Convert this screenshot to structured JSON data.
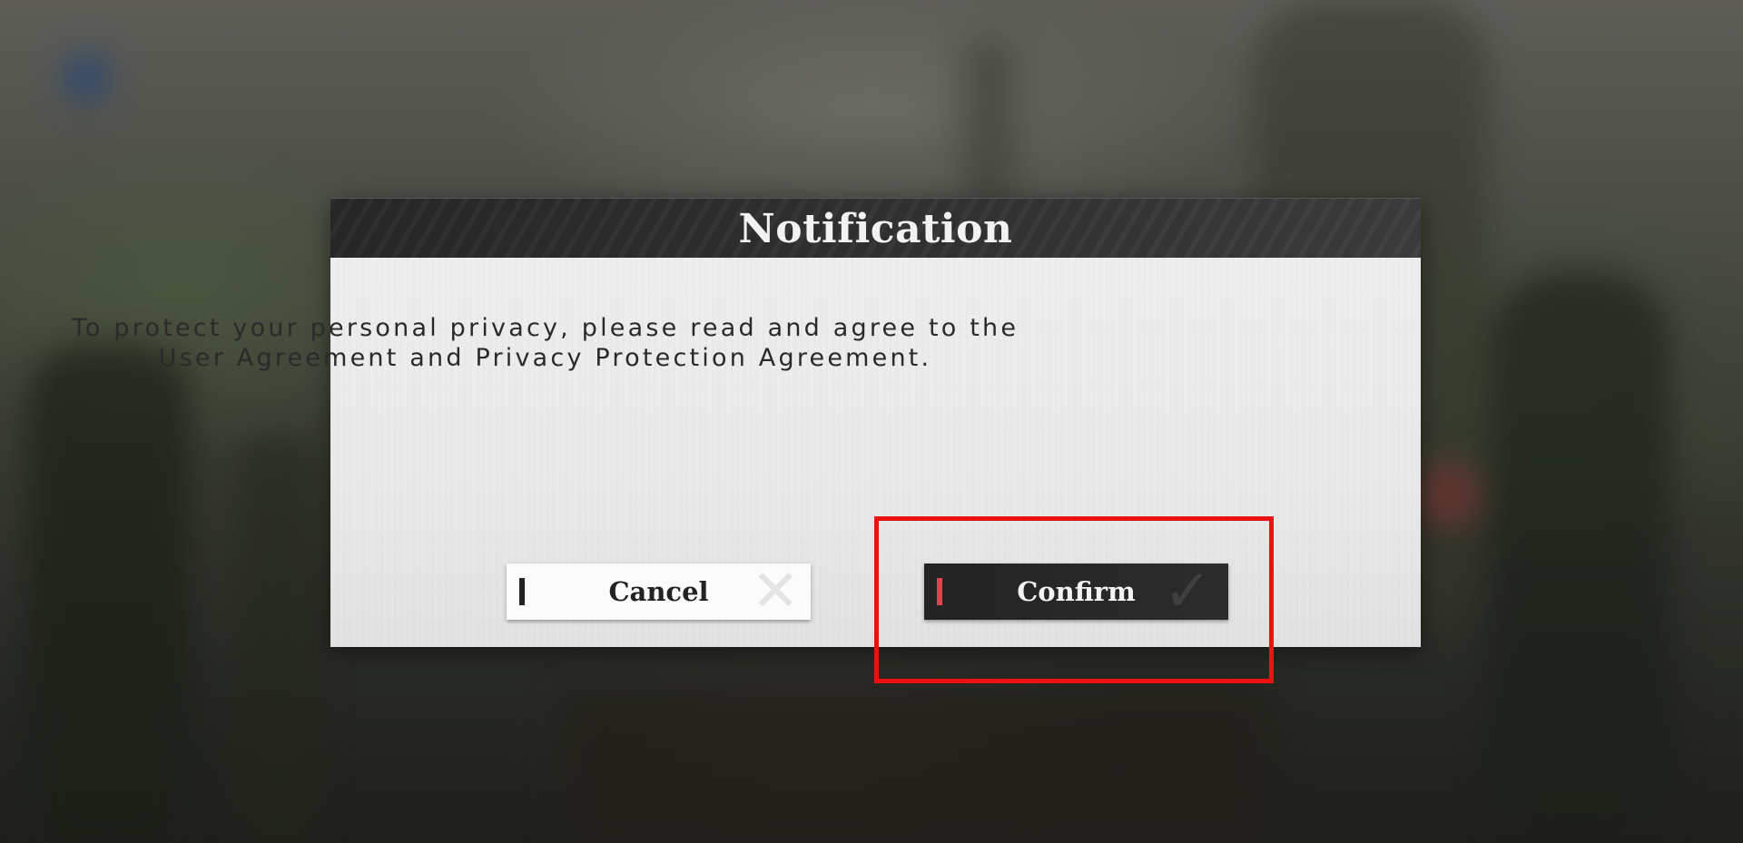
{
  "dialog": {
    "title": "Notification",
    "message_lines": [
      "To protect your personal privacy, please read and agree to the",
      "User Agreement and Privacy Protection Agreement."
    ],
    "cancel_label": "Cancel",
    "confirm_label": "Confirm",
    "cancel_icon": "close-icon",
    "confirm_icon": "checkmark-icon"
  },
  "colors": {
    "confirm_accent": "#e0414c",
    "highlight": "#ee1111",
    "header_bg": "#2f2f2f",
    "body_bg": "#e9e9e9"
  }
}
